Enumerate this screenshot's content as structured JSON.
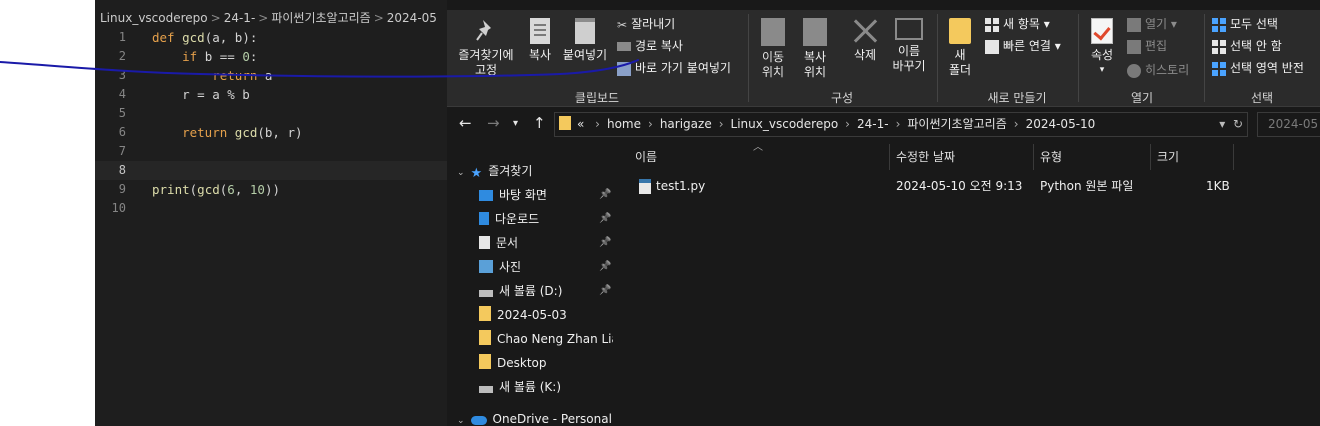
{
  "editor": {
    "breadcrumb": [
      "Linux_vscoderepo",
      "24-1-",
      "파이썬기초알고리즘",
      "2024-05"
    ],
    "lines": [
      {
        "n": "1",
        "active": false,
        "tokens": [
          [
            "kw",
            "def "
          ],
          [
            "fn",
            "gcd"
          ],
          [
            "pl",
            "(a, b):"
          ]
        ]
      },
      {
        "n": "2",
        "active": false,
        "tokens": [
          [
            "pl",
            "    "
          ],
          [
            "kw",
            "if"
          ],
          [
            "pl",
            " b == "
          ],
          [
            "nm",
            "0"
          ],
          [
            "pl",
            ":"
          ]
        ]
      },
      {
        "n": "3",
        "active": false,
        "tokens": [
          [
            "pl",
            "        "
          ],
          [
            "kw",
            "return"
          ],
          [
            "pl",
            " a"
          ]
        ]
      },
      {
        "n": "4",
        "active": false,
        "tokens": [
          [
            "pl",
            "    r = a % b"
          ]
        ]
      },
      {
        "n": "5",
        "active": false,
        "tokens": []
      },
      {
        "n": "6",
        "active": false,
        "tokens": [
          [
            "pl",
            "    "
          ],
          [
            "kw",
            "return"
          ],
          [
            "pl",
            " "
          ],
          [
            "fn",
            "gcd"
          ],
          [
            "pl",
            "(b, r)"
          ]
        ]
      },
      {
        "n": "7",
        "active": false,
        "tokens": []
      },
      {
        "n": "8",
        "active": true,
        "tokens": []
      },
      {
        "n": "9",
        "active": false,
        "tokens": [
          [
            "fn",
            "print"
          ],
          [
            "pl",
            "("
          ],
          [
            "fn",
            "gcd"
          ],
          [
            "pl",
            "("
          ],
          [
            "nm",
            "6"
          ],
          [
            "pl",
            ", "
          ],
          [
            "nm",
            "10"
          ],
          [
            "pl",
            "))"
          ]
        ]
      },
      {
        "n": "10",
        "active": false,
        "tokens": []
      }
    ]
  },
  "ribbon": {
    "pin_label": "즐겨찾기에\n고정",
    "copy_label": "복사",
    "paste_label": "붙여넣기",
    "cut_label": "잘라내기",
    "copy_path_label": "경로 복사",
    "paste_shortcut_label": "바로 가기 붙여넣기",
    "clipboard_group": "클립보드",
    "move_to_label": "이동\n위치",
    "copy_to_label": "복사\n위치",
    "delete_label": "삭제",
    "rename_label": "이름\n바꾸기",
    "organize_group": "구성",
    "new_folder_label": "새\n폴더",
    "new_item_label": "새 항목",
    "easy_access_label": "빠른 연결",
    "new_group": "새로 만들기",
    "properties_label": "속성",
    "open_label": "열기",
    "edit_label": "편집",
    "history_label": "히스토리",
    "open_group": "열기",
    "select_all_label": "모두 선택",
    "select_none_label": "선택 안 함",
    "invert_selection_label": "선택 영역 반전",
    "select_group": "선택"
  },
  "address": {
    "prefix": "«",
    "segments": [
      "home",
      "harigaze",
      "Linux_vscoderepo",
      "24-1-",
      "파이썬기초알고리즘",
      "2024-05-10"
    ],
    "search_placeholder": "2024-05"
  },
  "navpane": {
    "quick_access": "즐겨찾기",
    "items": [
      {
        "label": "바탕 화면",
        "icon": "desktop-icon",
        "pinned": true
      },
      {
        "label": "다운로드",
        "icon": "download-icon",
        "pinned": true
      },
      {
        "label": "문서",
        "icon": "document-icon",
        "pinned": true
      },
      {
        "label": "사진",
        "icon": "picture-icon",
        "pinned": true
      },
      {
        "label": "새 볼륨 (D:)",
        "icon": "drive-icon",
        "pinned": true
      },
      {
        "label": "2024-05-03",
        "icon": "folder-icon",
        "pinned": false
      },
      {
        "label": "Chao Neng Zhan Liar",
        "icon": "folder-icon",
        "pinned": false
      },
      {
        "label": "Desktop",
        "icon": "folder-icon",
        "pinned": false
      },
      {
        "label": "새 볼륨 (K:)",
        "icon": "drive-icon",
        "pinned": false
      }
    ],
    "onedrive": "OneDrive - Personal"
  },
  "filelist": {
    "columns": [
      "이름",
      "수정한 날짜",
      "유형",
      "크기"
    ],
    "files": [
      {
        "name": "test1.py",
        "modified": "2024-05-10 오전 9:13",
        "type": "Python 원본 파일",
        "size": "1KB"
      }
    ]
  },
  "colors": {
    "editor_bg": "#1e1e1e",
    "explorer_bg": "#191919",
    "ribbon_bg": "#2b2b2b",
    "keyword": "#e5a04b",
    "pen_stroke": "#1a1aa8"
  }
}
